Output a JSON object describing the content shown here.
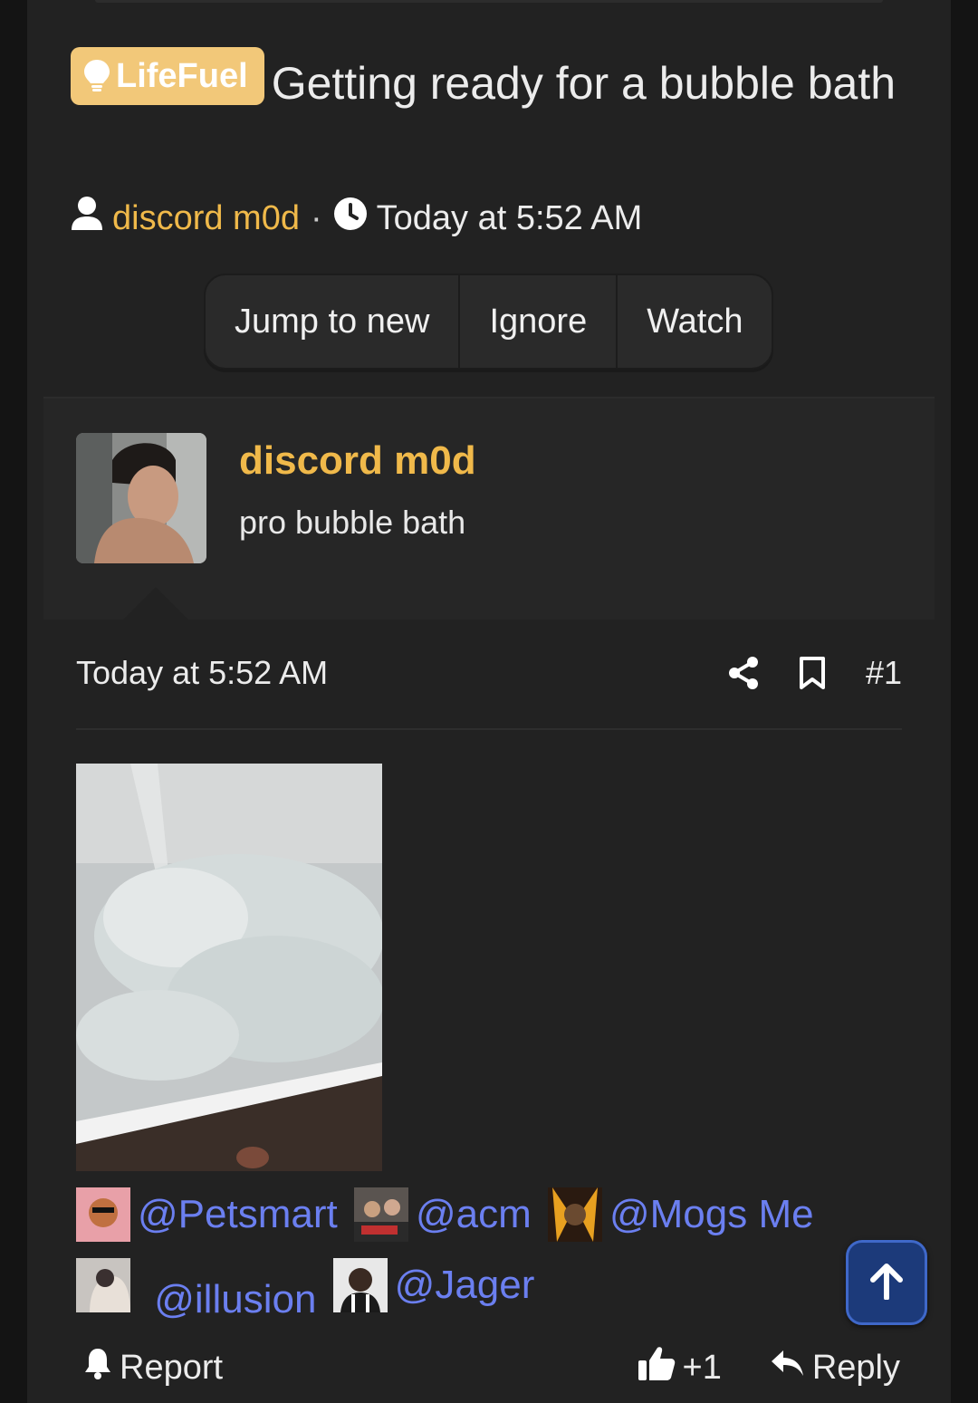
{
  "thread": {
    "prefix": "LifeFuel",
    "title": "Getting ready for a bubble bath",
    "author": "discord m0d",
    "separator": "·",
    "date": "Today at 5:52 AM"
  },
  "thread_actions": {
    "jump_to_new": "Jump to new",
    "ignore": "Ignore",
    "watch": "Watch"
  },
  "post": {
    "username": "discord m0d",
    "user_title": "pro bubble bath",
    "date": "Today at 5:52 AM",
    "number": "#1",
    "mentions": [
      {
        "name": "@Petsmart"
      },
      {
        "name": "@acm"
      },
      {
        "name": "@Mogs Me"
      },
      {
        "name": "@illusion"
      },
      {
        "name": "@Jager"
      }
    ]
  },
  "post_footer": {
    "report": "Report",
    "reaction_count": "+1",
    "reply": "Reply"
  },
  "icons": {
    "prefix": "lightbulb-icon",
    "author": "user-icon",
    "time": "clock-icon",
    "share": "share-icon",
    "bookmark": "bookmark-icon",
    "scroll_top": "arrow-up-icon",
    "report": "bell-icon",
    "like": "thumbs-up-icon",
    "reply": "reply-icon"
  },
  "colors": {
    "accent": "#f0b94a",
    "prefix_bg": "#f2c879",
    "mention": "#6b7ff0",
    "scroll_button": "#1c3a7a"
  }
}
